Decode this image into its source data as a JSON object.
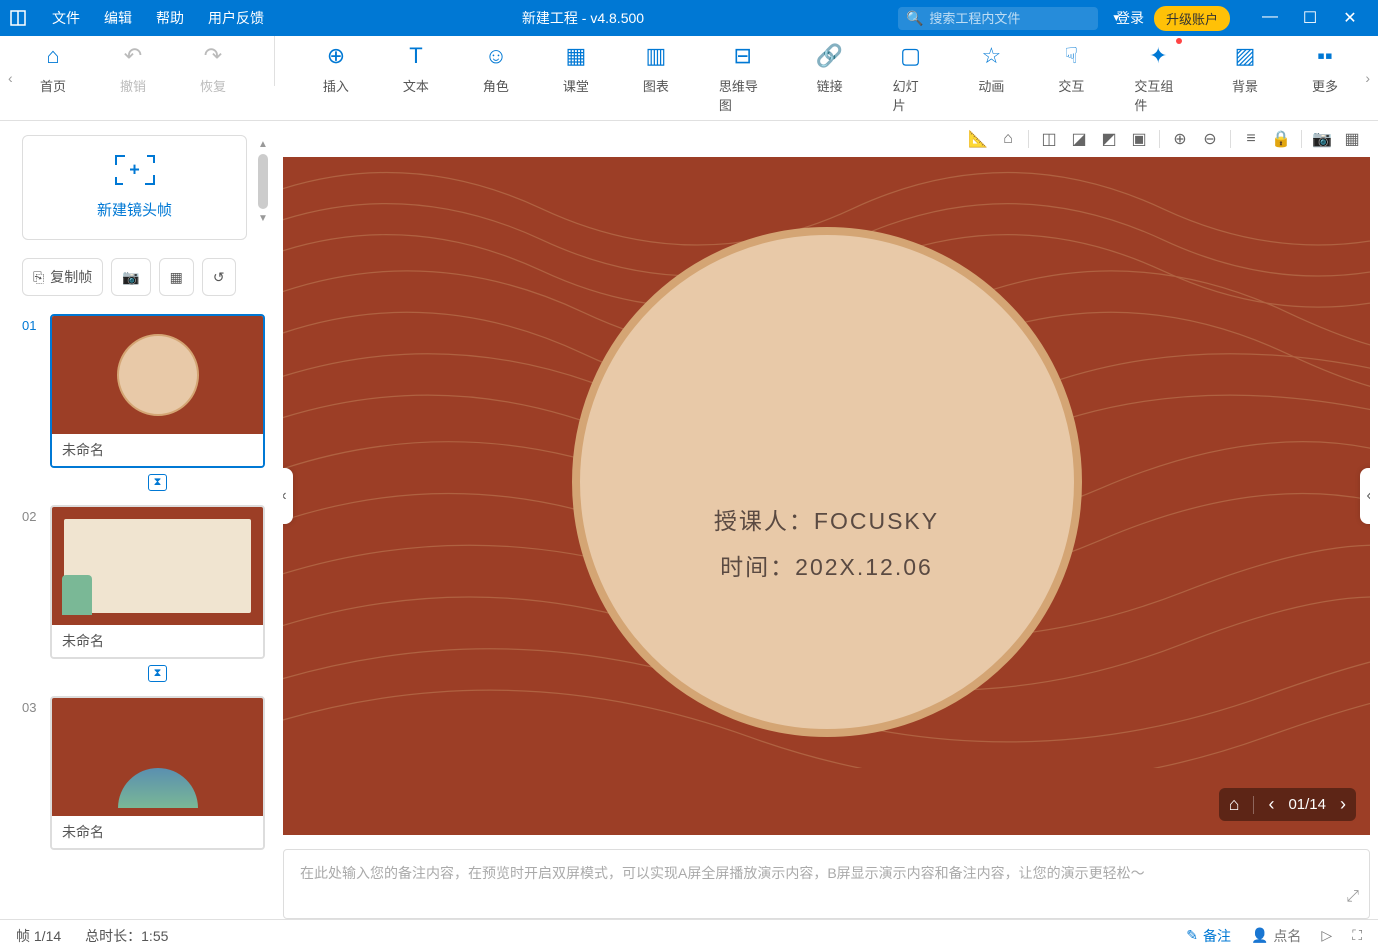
{
  "titlebar": {
    "menus": [
      "文件",
      "编辑",
      "帮助",
      "用户反馈"
    ],
    "title": "新建工程 - v4.8.500",
    "search_placeholder": "搜索工程内文件",
    "login": "登录",
    "upgrade": "升级账户"
  },
  "ribbon": {
    "items": [
      {
        "id": "home",
        "label": "首页",
        "icon": "⌂"
      },
      {
        "id": "undo",
        "label": "撤销",
        "icon": "↶",
        "disabled": true
      },
      {
        "id": "redo",
        "label": "恢复",
        "icon": "↷",
        "disabled": true
      },
      {
        "id": "insert",
        "label": "插入",
        "icon": "⊕"
      },
      {
        "id": "text",
        "label": "文本",
        "icon": "T"
      },
      {
        "id": "character",
        "label": "角色",
        "icon": "☺"
      },
      {
        "id": "classroom",
        "label": "课堂",
        "icon": "▦"
      },
      {
        "id": "chart",
        "label": "图表",
        "icon": "▥"
      },
      {
        "id": "mindmap",
        "label": "思维导图",
        "icon": "⊟"
      },
      {
        "id": "link",
        "label": "链接",
        "icon": "🔗"
      },
      {
        "id": "slide",
        "label": "幻灯片",
        "icon": "▢"
      },
      {
        "id": "animation",
        "label": "动画",
        "icon": "☆"
      },
      {
        "id": "interact",
        "label": "交互",
        "icon": "☟"
      },
      {
        "id": "widget",
        "label": "交互组件",
        "icon": "✦",
        "badge": true
      },
      {
        "id": "background",
        "label": "背景",
        "icon": "▨"
      },
      {
        "id": "more",
        "label": "更多",
        "icon": "▪▪"
      }
    ]
  },
  "sidebar": {
    "new_frame_label": "新建镜头帧",
    "tools": {
      "copy": "复制帧"
    },
    "thumbs": [
      {
        "num": "01",
        "title": "未命名",
        "active": true
      },
      {
        "num": "02",
        "title": "未命名",
        "active": false
      },
      {
        "num": "03",
        "title": "未命名",
        "active": false
      }
    ]
  },
  "canvas": {
    "lecturer_line": "授课人：FOCUSKY",
    "date_line": "时间：202X.12.06",
    "nav_counter": "01/14"
  },
  "notes": {
    "placeholder": "在此处输入您的备注内容，在预览时开启双屏模式，可以实现A屏全屏播放演示内容，B屏显示演示内容和备注内容，让您的演示更轻松～"
  },
  "statusbar": {
    "frame": "帧 1/14",
    "duration": "总时长：1:55",
    "notes_btn": "备注",
    "names_btn": "点名"
  }
}
